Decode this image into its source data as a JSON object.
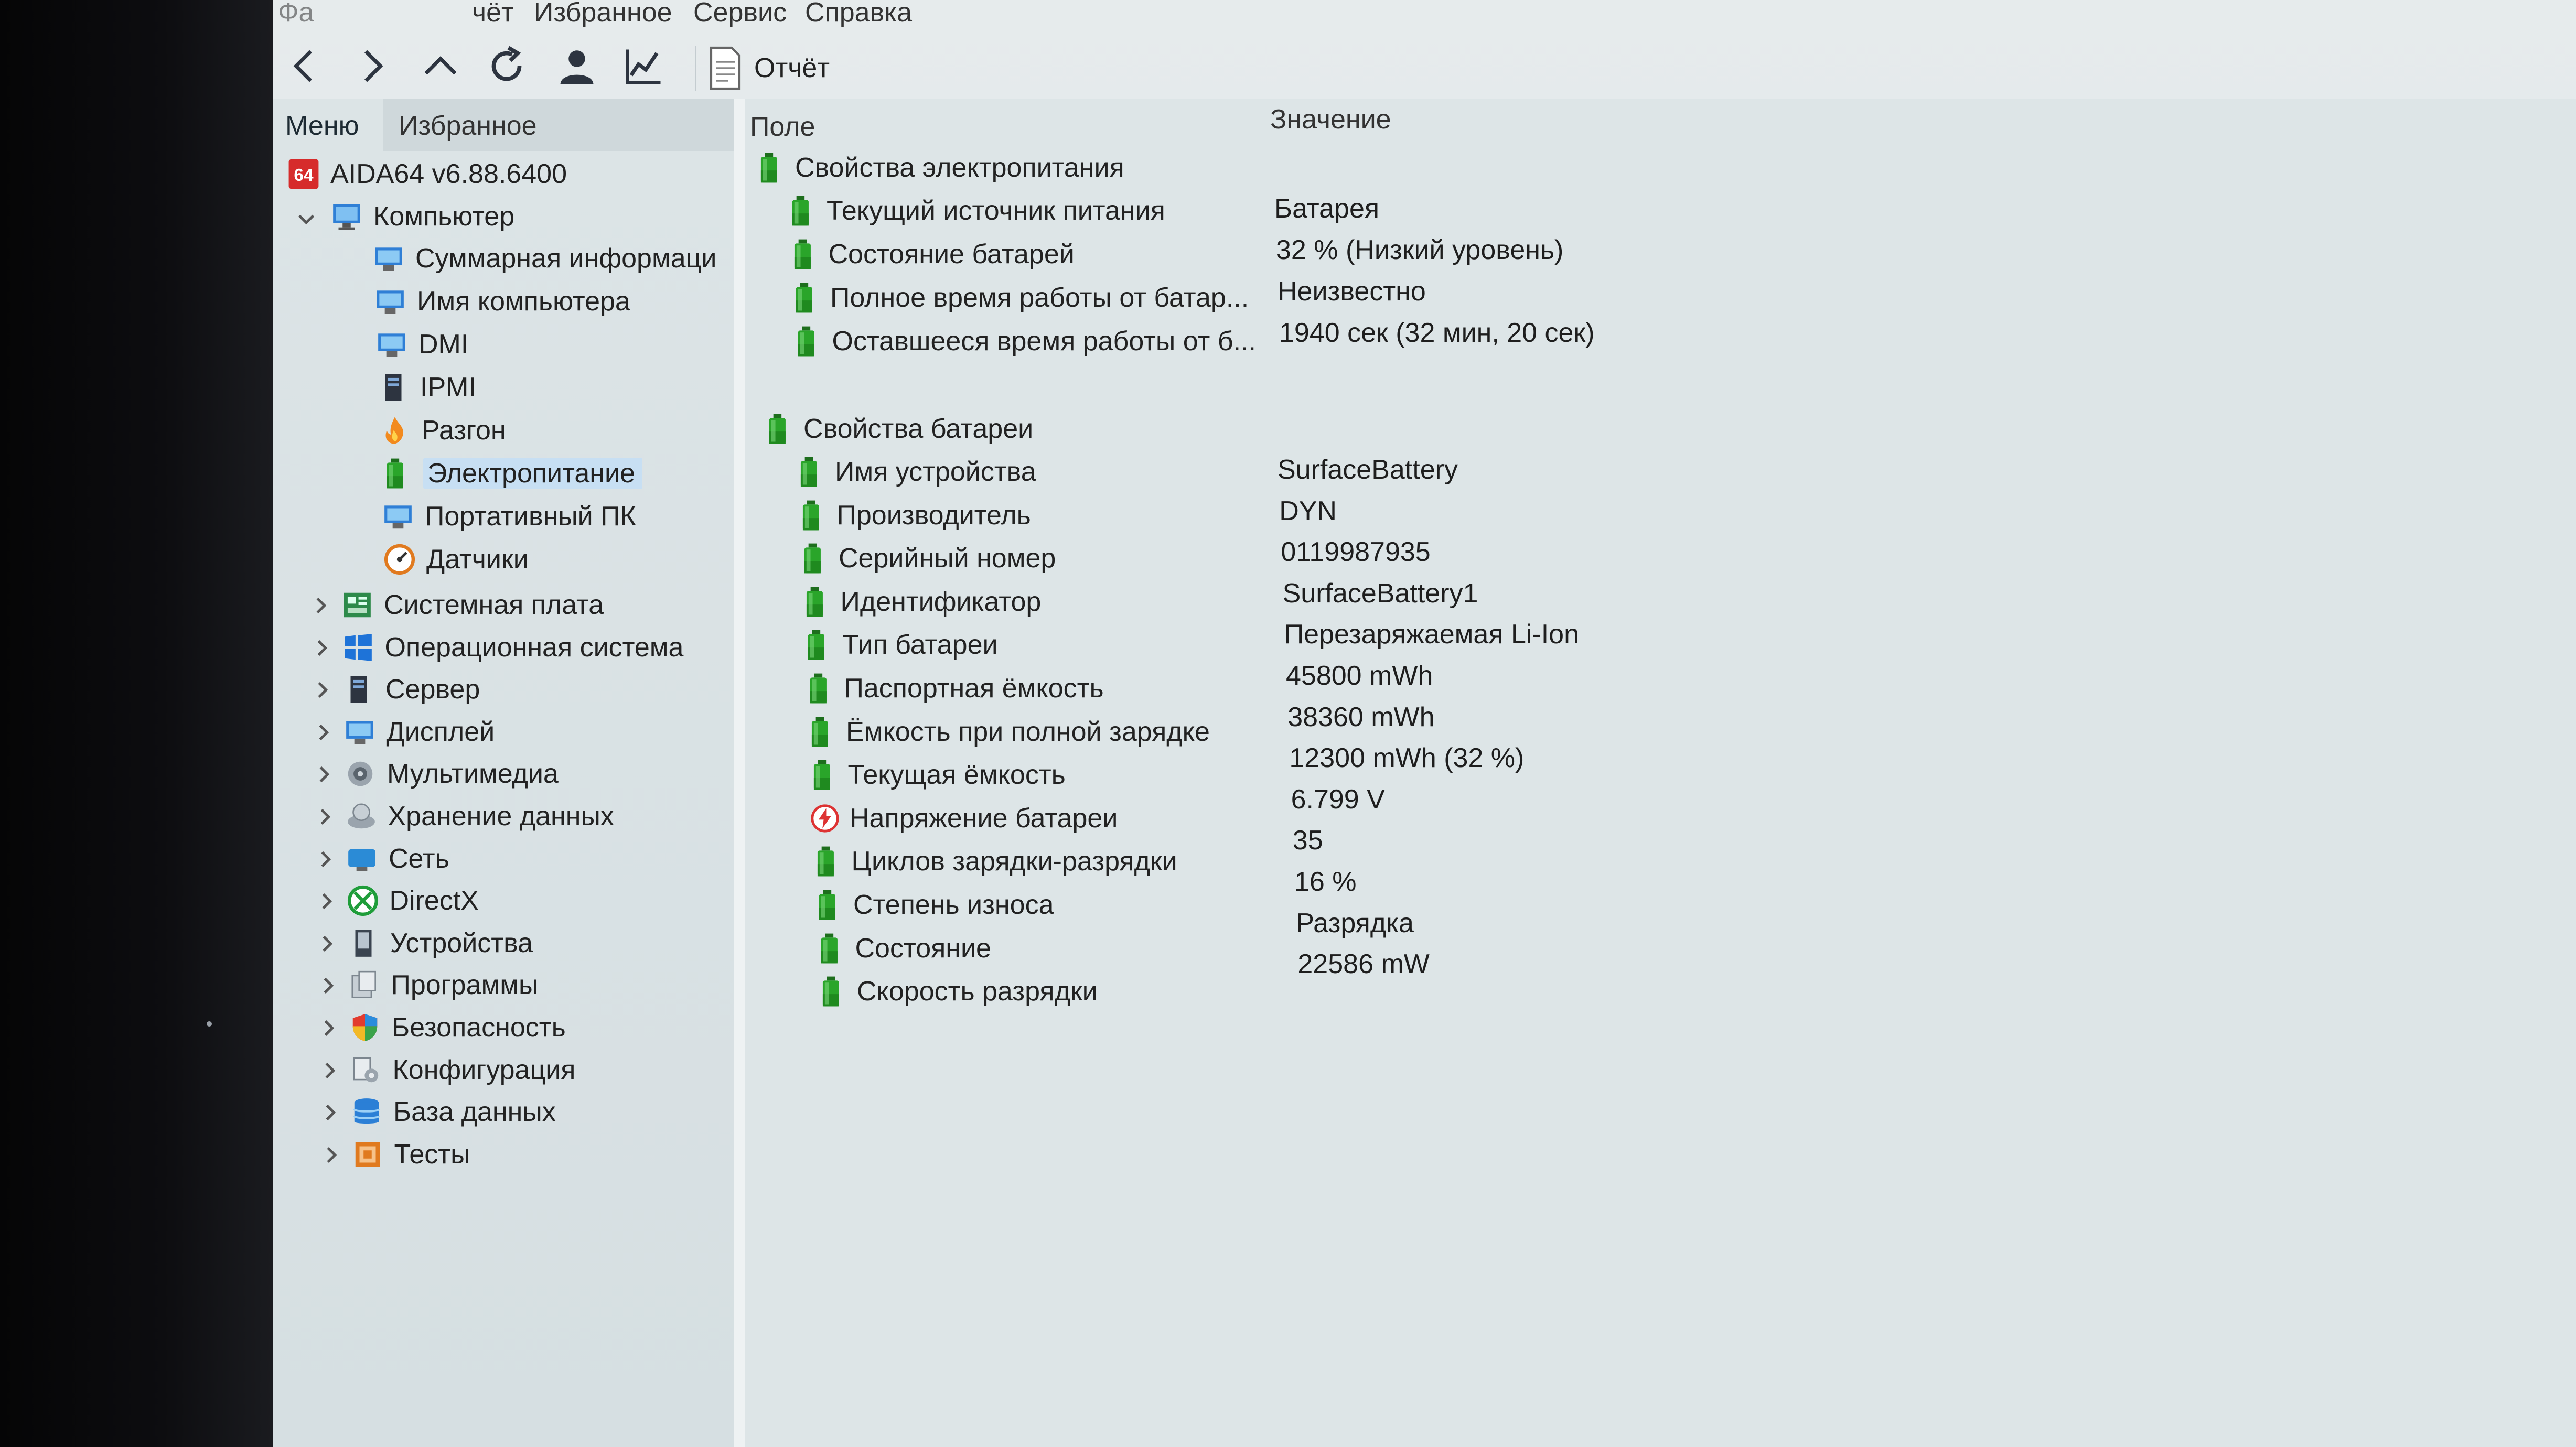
{
  "menubar": {
    "items": [
      "Фа",
      "чёт",
      "Избранное",
      "Сервис",
      "Справка"
    ]
  },
  "toolbar": {
    "buttons": [
      "back-icon",
      "forward-icon",
      "up-icon",
      "refresh-icon",
      "user-icon",
      "chart-icon"
    ],
    "report_label": "Отчёт"
  },
  "left_panel": {
    "tabs": [
      "Меню",
      "Избранное"
    ],
    "root": "AIDA64 v6.88.6400",
    "computer": "Компьютер",
    "computer_children": [
      "Суммарная информаци",
      "Имя компьютера",
      "DMI",
      "IPMI",
      "Разгон",
      "Электропитание",
      "Портативный ПК",
      "Датчики"
    ],
    "categories": [
      "Системная плата",
      "Операционная система",
      "Сервер",
      "Дисплей",
      "Мультимедиа",
      "Хранение данных",
      "Сеть",
      "DirectX",
      "Устройства",
      "Программы",
      "Безопасность",
      "Конфигурация",
      "База данных",
      "Тесты"
    ]
  },
  "right_panel": {
    "columns": {
      "field": "Поле",
      "value": "Значение"
    },
    "groups": [
      {
        "title": "Свойства электропитания",
        "rows": [
          {
            "field": "Текущий источник питания",
            "value": "Батарея"
          },
          {
            "field": "Состояние батарей",
            "value": "32 % (Низкий уровень)"
          },
          {
            "field": "Полное время работы от батар...",
            "value": "Неизвестно"
          },
          {
            "field": "Оставшееся время работы от б...",
            "value": "1940 сек (32 мин, 20 сек)"
          }
        ]
      },
      {
        "title": "Свойства батареи",
        "rows": [
          {
            "field": "Имя устройства",
            "value": "SurfaceBattery"
          },
          {
            "field": "Производитель",
            "value": "DYN"
          },
          {
            "field": "Серийный номер",
            "value": "0119987935"
          },
          {
            "field": "Идентификатор",
            "value": "SurfaceBattery1"
          },
          {
            "field": "Тип батареи",
            "value": "Перезаряжаемая Li-Ion"
          },
          {
            "field": "Паспортная ёмкость",
            "value": "45800 mWh"
          },
          {
            "field": "Ёмкость при полной зарядке",
            "value": "38360 mWh"
          },
          {
            "field": "Текущая ёмкость",
            "value": "12300 mWh  (32 %)"
          },
          {
            "field": "Напряжение батареи",
            "value": "6.799 V"
          },
          {
            "field": "Циклов зарядки-разрядки",
            "value": "35"
          },
          {
            "field": "Степень износа",
            "value": "16 %"
          },
          {
            "field": "Состояние",
            "value": "Разрядка"
          },
          {
            "field": "Скорость разрядки",
            "value": "22586 mW"
          }
        ]
      }
    ]
  },
  "colors": {
    "battery_icon": "#2aa52a",
    "selection": "#c7dff3",
    "screen_bg": "#e2e8ea"
  }
}
